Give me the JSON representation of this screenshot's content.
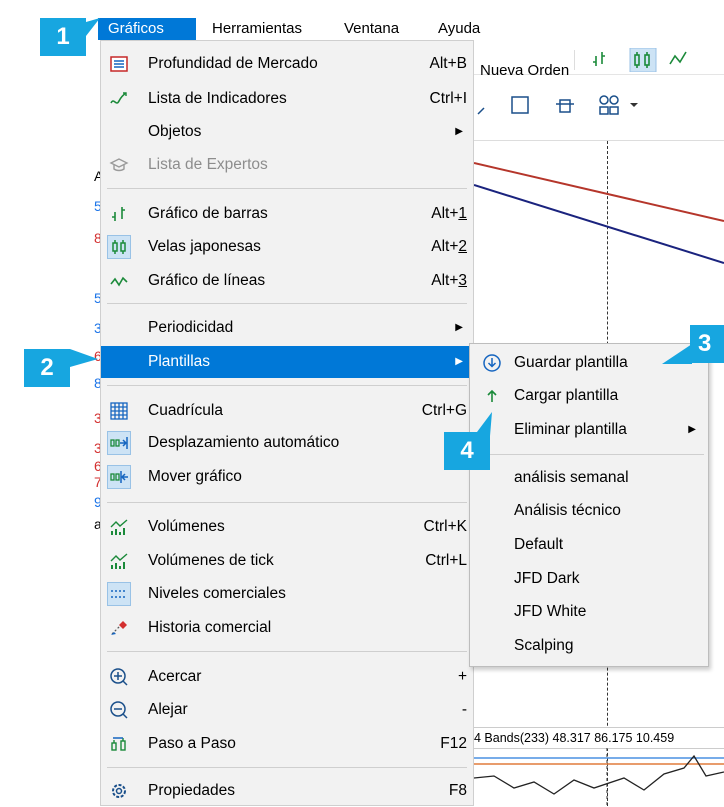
{
  "menubar": {
    "items": [
      "Gráficos",
      "Herramientas",
      "Ventana",
      "Ayuda"
    ]
  },
  "toolbar": {
    "new_order": "Nueva Orden"
  },
  "indicator_text": "4 Bands(233) 48.317 86.175 10.459",
  "main_menu": {
    "items": [
      {
        "label": "Profundidad de Mercado",
        "shortcut": "Alt+B",
        "icon": "market-depth-icon"
      },
      {
        "label": "Lista de Indicadores",
        "shortcut": "Ctrl+I",
        "icon": "indicators-icon"
      },
      {
        "label": "Objetos",
        "submenu": true
      },
      {
        "label": "Lista de Expertos",
        "disabled": true,
        "icon": "experts-icon"
      },
      {
        "label": "Gráfico de barras",
        "shortcut": "Alt+1",
        "icon": "bar-chart-icon"
      },
      {
        "label": "Velas japonesas",
        "shortcut": "Alt+2",
        "icon": "candlestick-icon"
      },
      {
        "label": "Gráfico de líneas",
        "shortcut": "Alt+3",
        "icon": "line-chart-icon"
      },
      {
        "label": "Periodicidad",
        "submenu": true
      },
      {
        "label": "Plantillas",
        "submenu": true,
        "highlighted": true
      },
      {
        "label": "Cuadrícula",
        "shortcut": "Ctrl+G",
        "icon": "grid-icon"
      },
      {
        "label": "Desplazamiento automático",
        "icon": "auto-scroll-icon"
      },
      {
        "label": "Mover gráfico",
        "icon": "chart-shift-icon"
      },
      {
        "label": "Volúmenes",
        "shortcut": "Ctrl+K",
        "icon": "volumes-icon"
      },
      {
        "label": "Volúmenes de tick",
        "shortcut": "Ctrl+L",
        "icon": "tick-volumes-icon"
      },
      {
        "label": "Niveles comerciales",
        "icon": "trade-levels-icon"
      },
      {
        "label": "Historia comercial",
        "icon": "trade-history-icon"
      },
      {
        "label": "Acercar",
        "shortcut": "+",
        "icon": "zoom-in-icon"
      },
      {
        "label": "Alejar",
        "shortcut": "-",
        "icon": "zoom-out-icon"
      },
      {
        "label": "Paso a Paso",
        "shortcut": "F12",
        "icon": "step-icon"
      },
      {
        "label": "Propiedades",
        "shortcut": "F8",
        "icon": "properties-icon"
      }
    ]
  },
  "sub_menu": {
    "items": [
      {
        "label": "Guardar plantilla",
        "icon": "save-template-icon"
      },
      {
        "label": "Cargar plantilla",
        "icon": "load-template-icon"
      },
      {
        "label": "Eliminar plantilla",
        "submenu": true
      },
      {
        "label": "análisis semanal"
      },
      {
        "label": "Análisis técnico"
      },
      {
        "label": "Default"
      },
      {
        "label": "JFD Dark"
      },
      {
        "label": "JFD White"
      },
      {
        "label": "Scalping"
      }
    ]
  },
  "callouts": [
    "1",
    "2",
    "3",
    "4"
  ],
  "left_chars": [
    "5",
    "8",
    "A",
    "5",
    "6",
    "3",
    "3",
    "6",
    "8",
    "3",
    "7",
    "9",
    "a"
  ],
  "colors": {
    "accent": "#0078d7",
    "callout": "#17a6e0",
    "menu_bg": "#f2f2f2",
    "red_line": "#b5362b",
    "navy_line": "#1a237e"
  }
}
